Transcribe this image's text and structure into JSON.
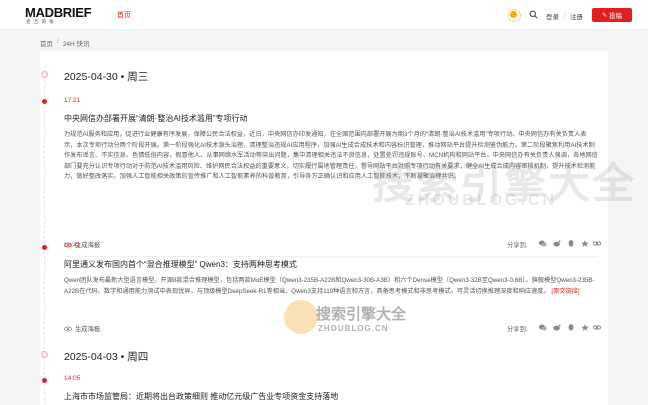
{
  "header": {
    "logo_main": "MADBRIEF",
    "logo_sub": "麦 吉 简 报",
    "nav_home": "首页",
    "login": "登录",
    "separator": "|",
    "register": "注册",
    "contribute": "投稿"
  },
  "breadcrumb": {
    "home": "首页",
    "separator": "/",
    "current": "24H 快讯"
  },
  "days": [
    {
      "date": "2025-04-30 • 周三"
    },
    {
      "date": "2025-04-03 • 周四"
    }
  ],
  "items": [
    {
      "time": "17:21",
      "title": "中央网信办部署开展“清朗·整治AI技术滥用”专项行动",
      "body": "为规范AI服务和应用，促进行业健康有序发展，保障公民合法权益，近日，中央网信办印发通知，在全国范围内部署开展为期3个月的“清朗·整治AI技术滥用”专项行动。中央网信办有关负责人表示，本次专项行动分两个阶段开展。第一阶段强化AI技术源头治理，清理整治违规AI应用程序，加强AI生成合成技术和内容标识管理，推动网站平台提升检测鉴伪能力。第二阶段聚焦利用AI技术制作发布谣言、不实信息、色情低俗内容，假冒他人、从事网络水军活动等突出问题，集中清理相关违法不良信息，处置处罚违规账号、MCN机构和网站平台。中央网信办有关负责人强调，各地网信部门要充分认识专项行动对于防范AI技术滥用风险、维护网民合法权益的重要意义，切实履行属地管理责任，督导网站平台对照专项行动有关要求，健全AI生成合成内容审核机制，提升技术检测能力，做好整改落实。加强人工智能相关政策的宣传推广和人工智能素养的科普教育，引导各方正确认识和应用人工智能技术，不断凝聚治理共识。",
      "orig": "",
      "view_label": "生成海报",
      "share_label": "分享到:"
    },
    {
      "time": "13:42",
      "title": "阿里通义发布国内首个“混合推理模型” Qwen3：支持两种思考模式",
      "body": "Qwen团队发布最新大型语言模型。开源8款混合推理模型，包括两款MoE模型（Qwen3-235B-A22B和Qwen3-30B-A3B）和六个Dense模型（Qwen3-32B至Qwen3-0.6B）。旗舰模型Qwen3-235B-A22B在代码、数学和通用能力测试中表现优异，与顶级模型DeepSeek-R1等相当。Qwen3支持119种语言和方言，具备思考模式和非思考模式，可灵活切换推理深度和响应速度。",
      "orig": "[原文链接]",
      "view_label": "生成海报",
      "share_label": "分享到:"
    },
    {
      "time": "14:05",
      "title": "上海市市场监管局：近期将出台政策细则 推动亿元级广告业专项资金支持落地",
      "body": "",
      "orig": "",
      "view_label": "",
      "share_label": ""
    }
  ],
  "watermark": {
    "big_cn": "搜索引擎大全",
    "big_en": "ZHOUBLOG.CN",
    "small_cn": "搜索引擎大全",
    "small_en": "ZHOUBLOG.CN"
  },
  "colors": {
    "brand_red": "#e02020",
    "text_dark": "#222222",
    "text_body": "#555555",
    "bg": "#f5f5f5"
  },
  "icons": [
    "sun-icon",
    "search-icon",
    "pen-icon",
    "eye-icon",
    "wechat-icon",
    "weibo-icon",
    "qq-icon",
    "qzone-icon",
    "link-icon"
  ]
}
